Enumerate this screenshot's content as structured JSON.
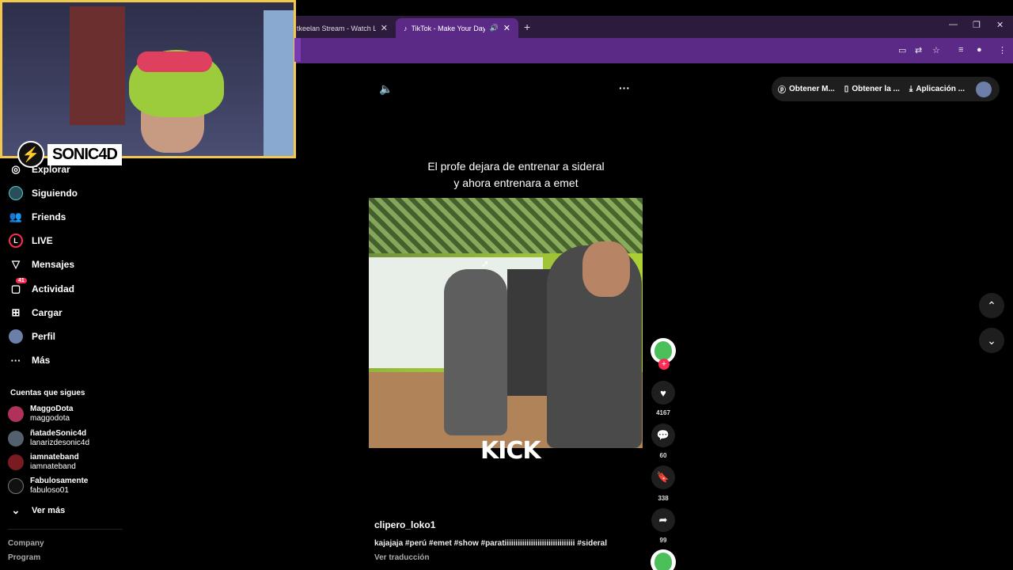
{
  "browser": {
    "tabs": [
      {
        "label": "tkeelan Stream - Watch Live"
      },
      {
        "label": "TikTok - Make Your Day"
      }
    ],
    "new_tab": "+",
    "minimize": "—",
    "restore": "❐",
    "close": "✕"
  },
  "webcam": {
    "logo_text": "SONIC4D"
  },
  "sidebar": {
    "items": [
      {
        "label": "Explorar",
        "icon": "compass-icon"
      },
      {
        "label": "Siguiendo",
        "icon": "following-icon"
      },
      {
        "label": "Friends",
        "icon": "friends-icon"
      },
      {
        "label": "LIVE",
        "icon": "live-icon"
      },
      {
        "label": "Mensajes",
        "icon": "messages-icon"
      },
      {
        "label": "Actividad",
        "icon": "activity-icon",
        "badge": "41"
      },
      {
        "label": "Cargar",
        "icon": "upload-icon"
      },
      {
        "label": "Perfil",
        "icon": "profile-icon"
      },
      {
        "label": "Más",
        "icon": "more-icon"
      }
    ],
    "following_title": "Cuentas que sigues",
    "following": [
      {
        "name": "MaggoDota",
        "handle": "maggodota"
      },
      {
        "name": "ñatadeSonic4d",
        "handle": "lanarizdesonic4d"
      },
      {
        "name": "iamnateband",
        "handle": "iamnateband"
      },
      {
        "name": "Fabulosamente",
        "handle": "fabuloso01"
      }
    ],
    "see_more": "Ver más",
    "footer": [
      "Company",
      "Program"
    ]
  },
  "video": {
    "caption_line1": "El profe dejara de entrenar a sideral",
    "caption_line2": "y ahora entrenara a emet",
    "overlay_text": "KICK",
    "username": "clipero_loko1",
    "description": "kajajaja #perú #emet #show #paratiiiiiiiiiiiiiiiiiiiiiiiiiiiiiiii #sideral",
    "translate": "Ver traducción",
    "likes": "4167",
    "comments": "60",
    "saves": "338",
    "shares": "99"
  },
  "topbar": {
    "pill1": "Obtener M...",
    "pill2": "Obtener la ...",
    "pill3": "Aplicación ..."
  },
  "colors": {
    "accent": "#fe2c55",
    "browser_purple": "#5b2a86",
    "webcam_border": "#f2c94c"
  }
}
